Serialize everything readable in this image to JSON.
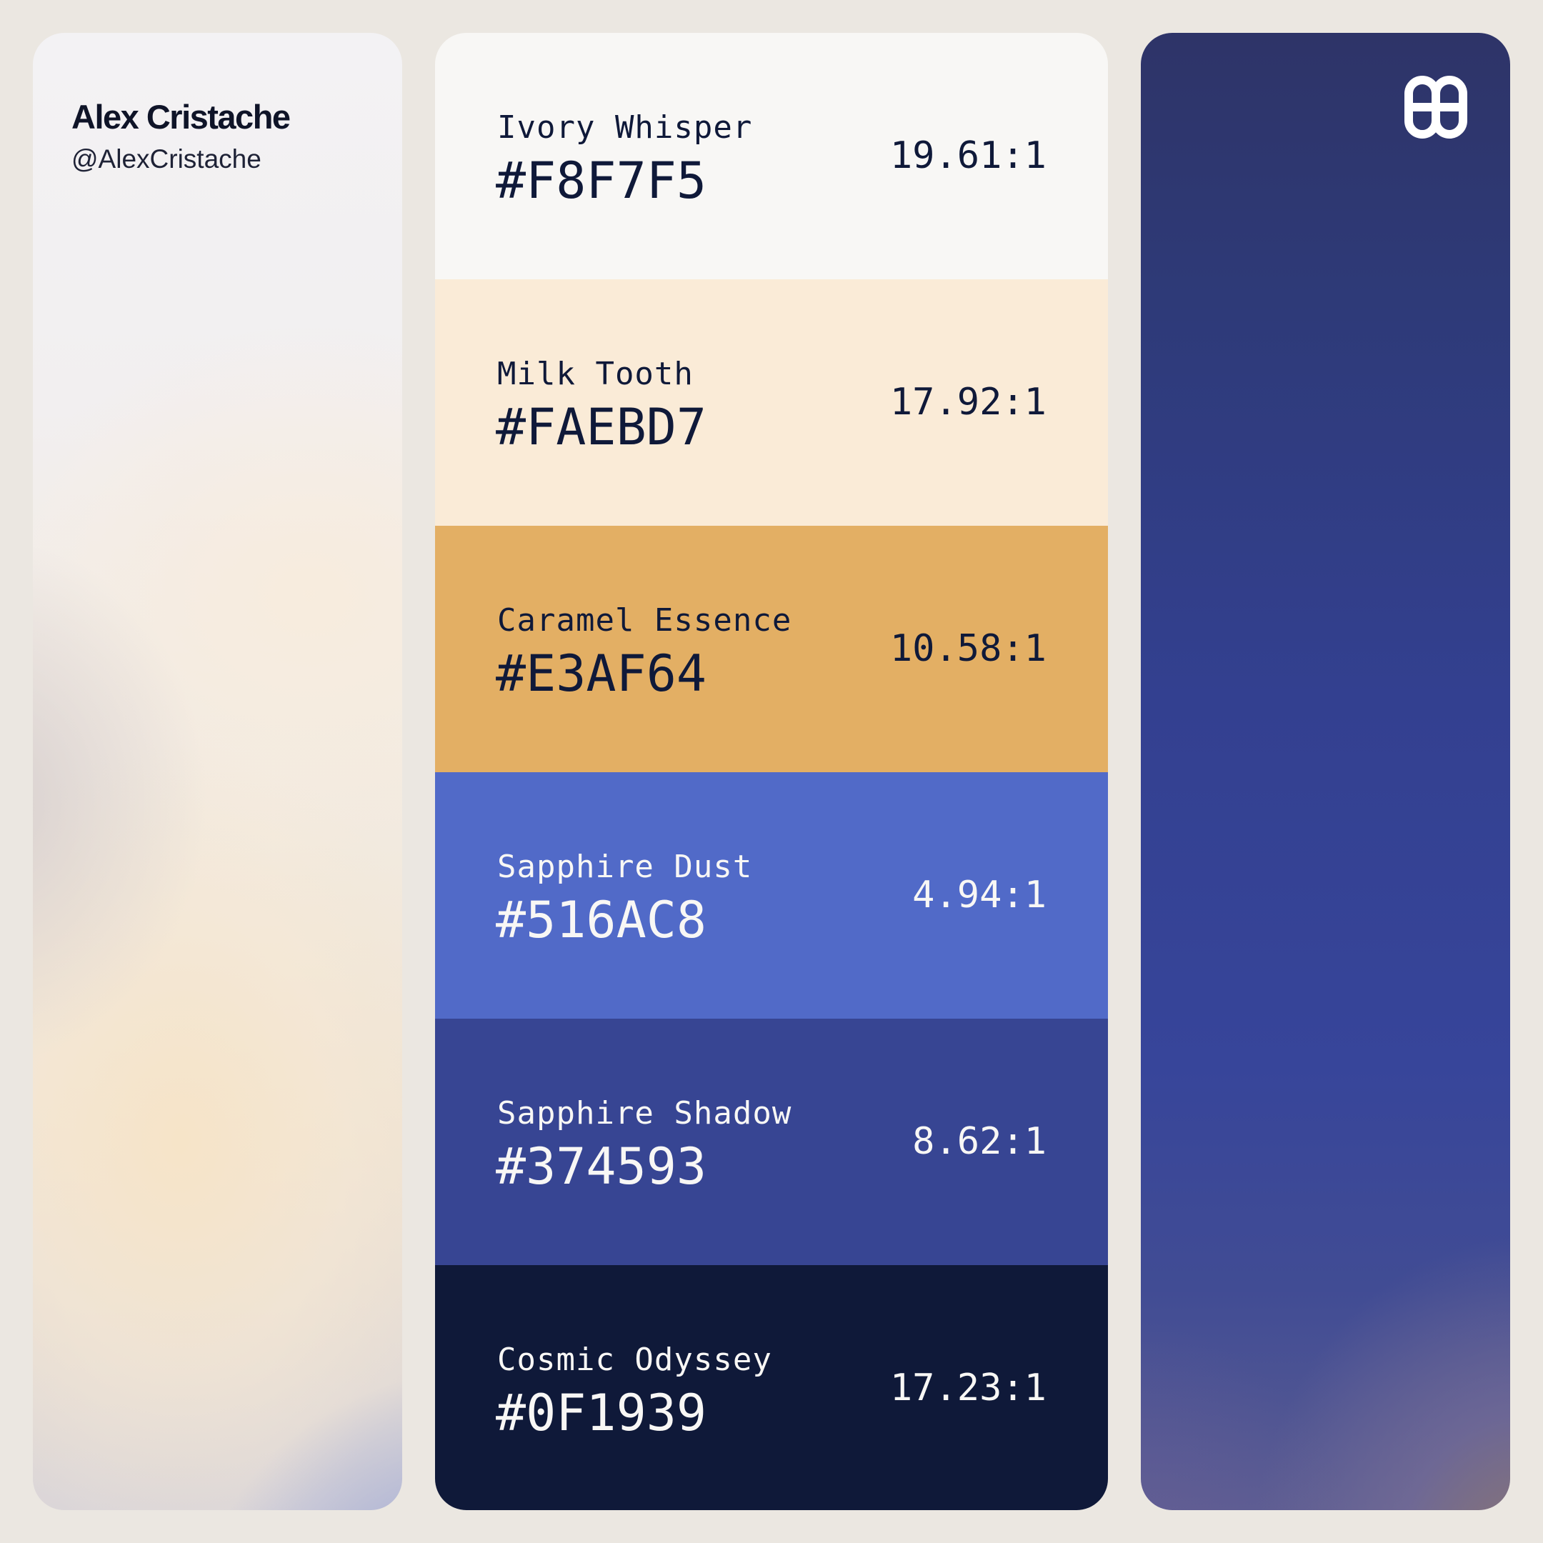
{
  "author": {
    "name": "Alex Cristache",
    "handle": "@AlexCristache"
  },
  "logo": {
    "icon": "double-loop-logo-icon",
    "color": "#FFFFFF"
  },
  "palette": [
    {
      "name": "Ivory Whisper",
      "hex": "#F8F7F5",
      "ratio": "19.61:1",
      "background": "#F8F7F5",
      "text_color": "#0F1939"
    },
    {
      "name": "Milk Tooth",
      "hex": "#FAEBD7",
      "ratio": "17.92:1",
      "background": "#FAEBD7",
      "text_color": "#0F1939"
    },
    {
      "name": "Caramel Essence",
      "hex": "#E3AF64",
      "ratio": "10.58:1",
      "background": "#E3AF64",
      "text_color": "#0F1939"
    },
    {
      "name": "Sapphire Dust",
      "hex": "#516AC8",
      "ratio": "4.94:1",
      "background": "#516AC8",
      "text_color": "#F8F7F5"
    },
    {
      "name": "Sapphire Shadow",
      "hex": "#374593",
      "ratio": "8.62:1",
      "background": "#374593",
      "text_color": "#F8F7F5"
    },
    {
      "name": "Cosmic Odyssey",
      "hex": "#0F1939",
      "ratio": "17.23:1",
      "background": "#0F1939",
      "text_color": "#F8F7F5"
    }
  ]
}
